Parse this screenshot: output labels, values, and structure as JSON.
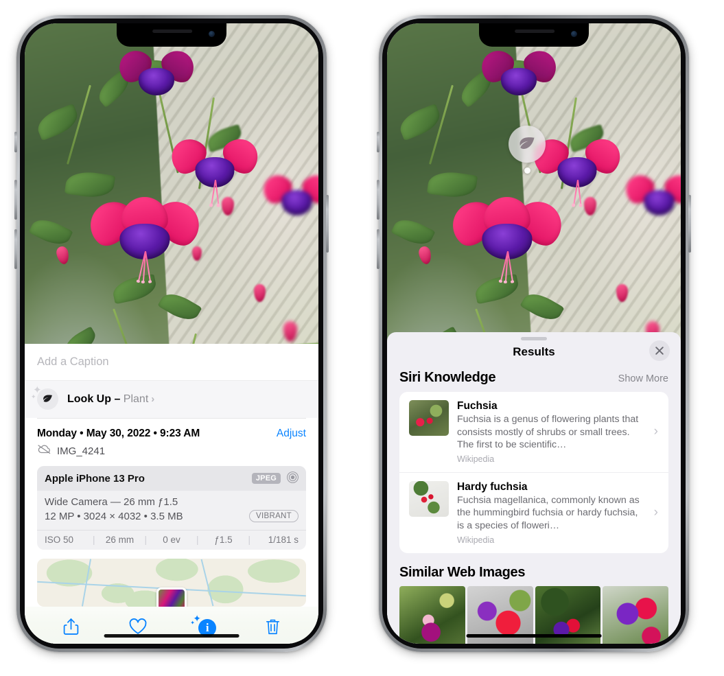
{
  "left_phone": {
    "name": "photos-detail-screen",
    "caption_placeholder": "Add a Caption",
    "lookup": {
      "icon": "leaf-icon",
      "label": "Look Up –",
      "subject": "Plant",
      "chevron": "›"
    },
    "meta": {
      "date_line": "Monday • May 30, 2022 • 9:23 AM",
      "adjust_label": "Adjust",
      "cloud_icon": "cloud-slash-icon",
      "filename": "IMG_4241"
    },
    "exif": {
      "model": "Apple iPhone 13 Pro",
      "format_badge": "JPEG",
      "raw_icon": "aperture-icon",
      "lens_line": "Wide Camera — 26 mm ƒ1.5",
      "size_line": "12 MP • 3024 × 4032 • 3.5 MB",
      "style_badge": "VIBRANT",
      "stats": [
        "ISO 50",
        "26 mm",
        "0 ev",
        "ƒ1.5",
        "1/181 s"
      ]
    },
    "toolbar": [
      {
        "name": "share-button",
        "icon": "share-icon"
      },
      {
        "name": "favorite-button",
        "icon": "heart-icon"
      },
      {
        "name": "info-button",
        "icon": "info-sparkle-icon",
        "glyph": "i",
        "active": true
      },
      {
        "name": "delete-button",
        "icon": "trash-icon"
      }
    ]
  },
  "right_phone": {
    "name": "visual-lookup-results-screen",
    "badge_icon": "leaf-icon",
    "sheet": {
      "title": "Results",
      "close_icon": "close-icon",
      "siri_knowledge": {
        "heading": "Siri Knowledge",
        "show_more": "Show More",
        "results": [
          {
            "title": "Fuchsia",
            "description": "Fuchsia is a genus of flowering plants that consists mostly of shrubs or small trees. The first to be scientific…",
            "source": "Wikipedia",
            "chevron": "›"
          },
          {
            "title": "Hardy fuchsia",
            "description": "Fuchsia magellanica, commonly known as the hummingbird fuchsia or hardy fuchsia, is a species of floweri…",
            "source": "Wikipedia",
            "chevron": "›"
          }
        ]
      },
      "similar_web_images": {
        "heading": "Similar Web Images",
        "count": 4
      }
    }
  },
  "colors": {
    "accent_blue": "#0a84ff",
    "sheet_background": "#f0eff4",
    "info_background": "#ffffff",
    "secondary_text": "#8e8e93"
  }
}
